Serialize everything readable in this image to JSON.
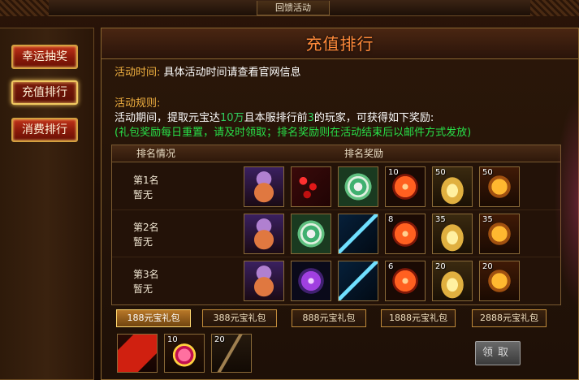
{
  "window": {
    "title": "回馈活动"
  },
  "nav": {
    "items": [
      {
        "label": "幸运抽奖"
      },
      {
        "label": "充值排行"
      },
      {
        "label": "消费排行"
      }
    ]
  },
  "panel": {
    "title": "充值排行",
    "time_label": "活动时间:",
    "time_text": "具体活动时间请查看官网信息",
    "rules_label": "活动规则:",
    "rule_part1": "活动期间，提取元宝达",
    "rule_amount": "10万",
    "rule_part2": "且本服排行前",
    "rule_rank": "3",
    "rule_part3": "的玩家，可获得如下奖励:",
    "note": "(礼包奖励每日重置，请及时领取；排名奖励则在活动结束后以邮件方式发放)"
  },
  "table": {
    "header_rank": "排名情况",
    "header_reward": "排名奖励",
    "rows": [
      {
        "rank": "第1名",
        "holder": "暂无",
        "items": [
          {
            "icon": "fish-mount-icon",
            "count": ""
          },
          {
            "icon": "red-chain-icon",
            "count": ""
          },
          {
            "icon": "jade-disc-icon",
            "count": ""
          },
          {
            "icon": "fire-orb-icon",
            "count": "10"
          },
          {
            "icon": "gold-ingot-icon",
            "count": "50"
          },
          {
            "icon": "tiger-medallion-icon",
            "count": "50"
          }
        ]
      },
      {
        "rank": "第2名",
        "holder": "暂无",
        "items": [
          {
            "icon": "fish-mount-icon",
            "count": ""
          },
          {
            "icon": "jade-disc-icon",
            "count": ""
          },
          {
            "icon": "ice-sword-icon",
            "count": ""
          },
          {
            "icon": "fire-orb-icon",
            "count": "8"
          },
          {
            "icon": "gold-ingot-icon",
            "count": "35"
          },
          {
            "icon": "tiger-medallion-icon",
            "count": "35"
          }
        ]
      },
      {
        "rank": "第3名",
        "holder": "暂无",
        "items": [
          {
            "icon": "fish-mount-icon",
            "count": ""
          },
          {
            "icon": "purple-orb-icon",
            "count": ""
          },
          {
            "icon": "ice-sword-icon",
            "count": ""
          },
          {
            "icon": "fire-orb-icon",
            "count": "6"
          },
          {
            "icon": "gold-ingot-icon",
            "count": "20"
          },
          {
            "icon": "tiger-medallion-icon",
            "count": "20"
          }
        ]
      }
    ]
  },
  "packages": [
    {
      "label": "188元宝礼包"
    },
    {
      "label": "388元宝礼包"
    },
    {
      "label": "888元宝礼包"
    },
    {
      "label": "1888元宝礼包"
    },
    {
      "label": "2888元宝礼包"
    }
  ],
  "package_items": [
    {
      "icon": "red-scroll-icon",
      "count": ""
    },
    {
      "icon": "ruby-gem-icon",
      "count": "10"
    },
    {
      "icon": "whip-icon",
      "count": "20"
    }
  ],
  "claim_button": "领取",
  "colors": {
    "accent": "#ff8a3a",
    "highlight": "#30d060",
    "gold": "#f0b040"
  }
}
